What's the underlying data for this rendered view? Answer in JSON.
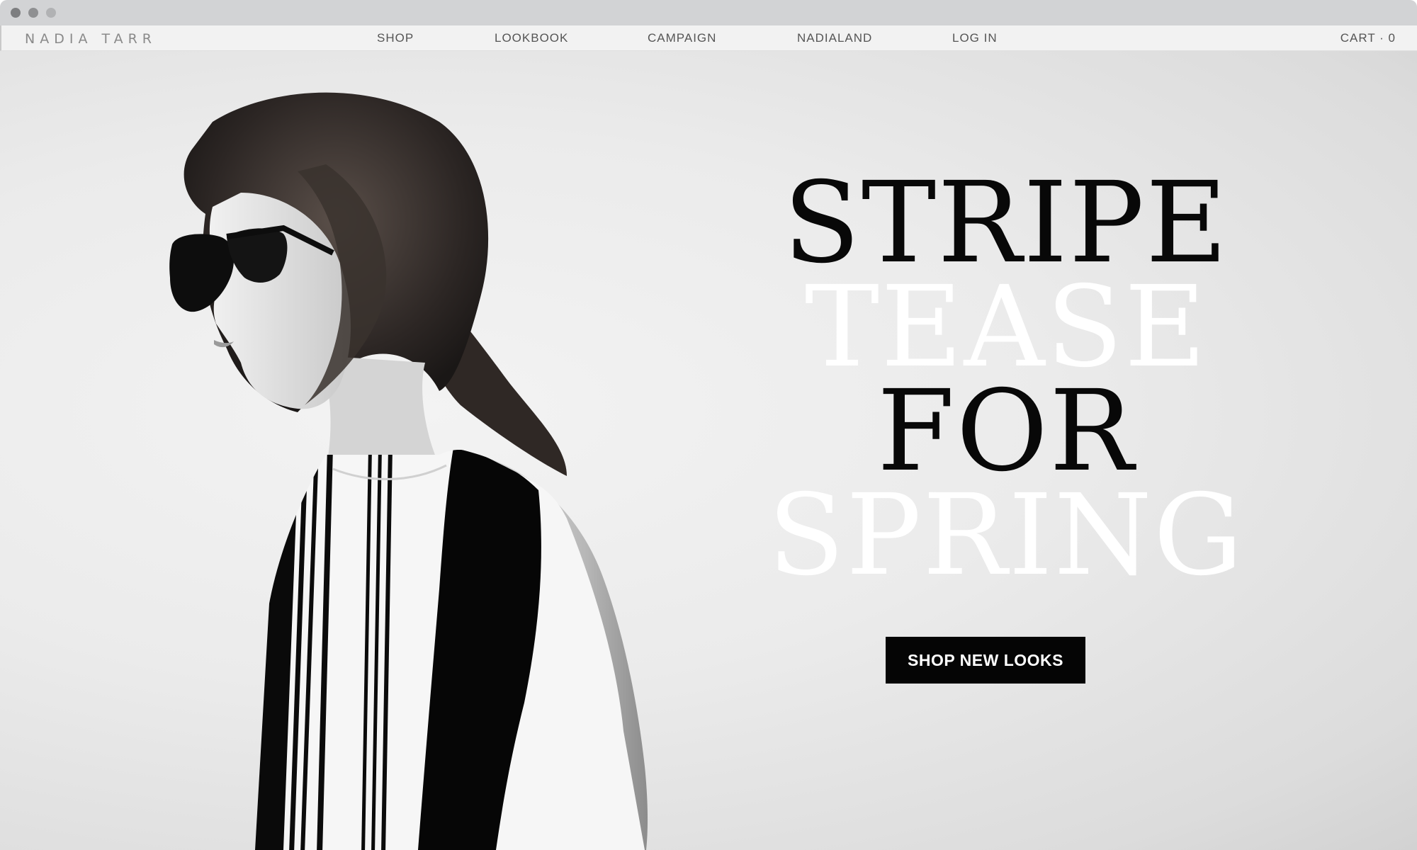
{
  "brand": "NADIA TARR",
  "nav": {
    "items": [
      "SHOP",
      "LOOKBOOK",
      "CAMPAIGN",
      "NADIALAND",
      "LOG IN"
    ],
    "cart_label": "CART · 0"
  },
  "hero": {
    "headline": {
      "line1": "STRIPE",
      "line2": "TEASE",
      "line3": "FOR",
      "line4": "SPRING"
    },
    "cta_label": "SHOP NEW LOOKS"
  },
  "colors": {
    "headline_dark": "#080808",
    "headline_light": "#ffffff",
    "cta_bg": "#050505",
    "nav_text": "#555555"
  }
}
